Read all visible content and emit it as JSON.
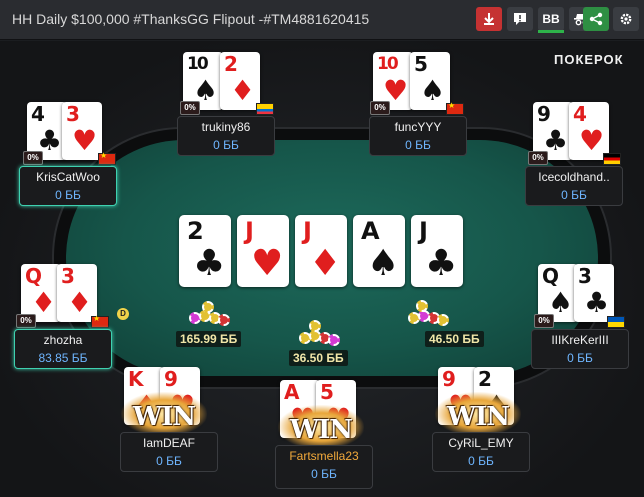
{
  "window": {
    "title": "HH Daily $100,000 #ThanksGG Flipout -#TM4881620415"
  },
  "toolbar": {
    "bb_label": "BB",
    "buttons": [
      {
        "icon": "download-icon",
        "color": "#c53232"
      },
      {
        "icon": "report-icon",
        "color": "#3a3d42"
      },
      {
        "icon": "bb-toggle",
        "color": "#3a3d42"
      },
      {
        "icon": "incognito-icon",
        "color": "#3a3d42"
      },
      {
        "icon": "share-icon",
        "color": "#2e8f43"
      },
      {
        "icon": "gear-icon",
        "color": "#3a3d42"
      }
    ]
  },
  "logo": "ПОКЕРОК",
  "board": [
    {
      "rank": "2",
      "suit": "♣",
      "color": "black"
    },
    {
      "rank": "J",
      "suit": "♥",
      "color": "red"
    },
    {
      "rank": "J",
      "suit": "♦",
      "color": "red"
    },
    {
      "rank": "A",
      "suit": "♠",
      "color": "black"
    },
    {
      "rank": "J",
      "suit": "♣",
      "color": "black"
    }
  ],
  "pots": [
    "165.99 ББ",
    "36.50 ББ",
    "46.50 ББ"
  ],
  "players": {
    "kriscatwoo": {
      "name": "KrisCatWoo",
      "stack": "0 ББ",
      "pct": "0%",
      "flag": "cn",
      "cards": [
        {
          "rank": "4",
          "suit": "♣"
        },
        {
          "rank": "3",
          "suit": "♥"
        }
      ]
    },
    "trukiny86": {
      "name": "trukiny86",
      "stack": "0 ББ",
      "pct": "0%",
      "flag": "ec",
      "cards": [
        {
          "rank": "10",
          "suit": "♠"
        },
        {
          "rank": "2",
          "suit": "♦"
        }
      ]
    },
    "funcyyy": {
      "name": "funcYYY",
      "stack": "0 ББ",
      "pct": "0%",
      "flag": "cn",
      "cards": [
        {
          "rank": "10",
          "suit": "♥"
        },
        {
          "rank": "5",
          "suit": "♠"
        }
      ]
    },
    "icecoldhand": {
      "name": "Icecoldhand..",
      "stack": "0 ББ",
      "pct": "0%",
      "flag": "de",
      "cards": [
        {
          "rank": "9",
          "suit": "♣"
        },
        {
          "rank": "4",
          "suit": "♥"
        }
      ]
    },
    "zhozha": {
      "name": "zhozha",
      "stack": "83.85 ББ",
      "pct": "0%",
      "flag": "cn",
      "dealer": "D",
      "cards": [
        {
          "rank": "Q",
          "suit": "♦"
        },
        {
          "rank": "3",
          "suit": "♦"
        }
      ]
    },
    "iiikrekeriii": {
      "name": "IIIKreKerIII",
      "stack": "0 ББ",
      "pct": "0%",
      "flag": "ua",
      "cards": [
        {
          "rank": "Q",
          "suit": "♠"
        },
        {
          "rank": "3",
          "suit": "♣"
        }
      ]
    },
    "iamdeaf": {
      "name": "IamDEAF",
      "stack": "0 ББ",
      "win": "WIN",
      "cards": [
        {
          "rank": "K",
          "suit": "♦"
        },
        {
          "rank": "9",
          "suit": "♥"
        }
      ]
    },
    "fartsmella23": {
      "name": "Fartsmella23",
      "stack": "0 ББ",
      "win": "WIN",
      "cards": [
        {
          "rank": "A",
          "suit": "♥"
        },
        {
          "rank": "5",
          "suit": "♥"
        }
      ]
    },
    "cyril_emy": {
      "name": "CyRiL_EMY",
      "stack": "0 ББ",
      "win": "WIN",
      "cards": [
        {
          "rank": "9",
          "suit": "♥"
        },
        {
          "rank": "2",
          "suit": "♠"
        }
      ]
    }
  },
  "colors": {
    "felt": "#16564a",
    "stack_text": "#6fb6ff",
    "pot_text": "#f0e6a8",
    "winner_name": "#f2a93b"
  }
}
